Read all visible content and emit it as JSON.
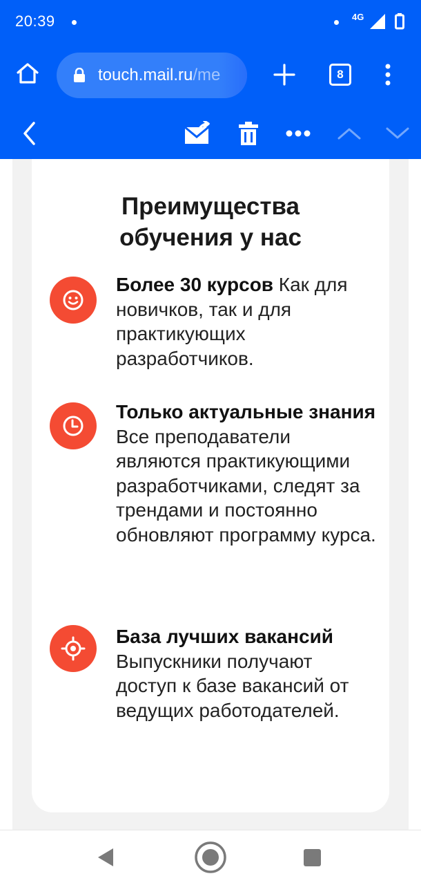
{
  "status_bar": {
    "time": "20:39",
    "network": "4G"
  },
  "browser": {
    "url_host": "touch.mail.ru",
    "url_path": "/me",
    "tab_count": "8"
  },
  "mail_toolbar": {
    "icons": [
      "back-icon",
      "move-to-folder-icon",
      "trash-icon",
      "more-icon",
      "previous-icon",
      "next-icon"
    ]
  },
  "card": {
    "title_line1": "Преимущества",
    "title_line2": "обучения у нас",
    "features": [
      {
        "icon": "smile-icon",
        "heading": "Более 30 курсов",
        "body": " Как для новичков, так и для практикующих разработчиков."
      },
      {
        "icon": "clock-icon",
        "heading": "Только актуальные знания",
        "body": " Все преподаватели являются практикующими разработчиками, следят за трендами и постоянно обновляют программу курса."
      },
      {
        "icon": "target-icon",
        "heading": "База лучших вакансий",
        "body": " Выпускники получают доступ к базе вакансий от ведущих работодателей."
      }
    ]
  },
  "colors": {
    "brand_blue": "#005ff9",
    "accent_red": "#f44b33"
  }
}
